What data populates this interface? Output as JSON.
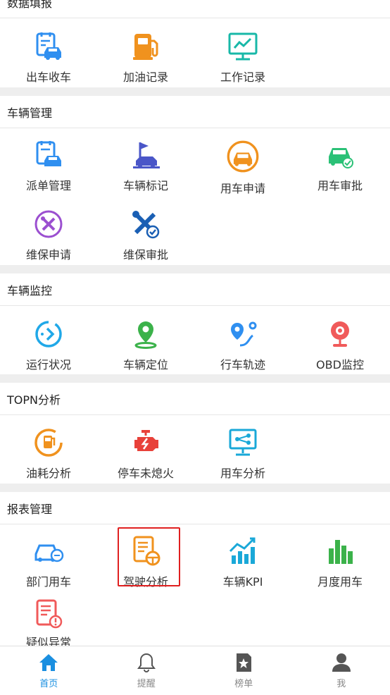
{
  "sections": {
    "data_entry": {
      "title": "数据填报",
      "items": [
        "出车收车",
        "加油记录",
        "工作记录"
      ]
    },
    "vehicle_mgmt": {
      "title": "车辆管理",
      "items": [
        "派单管理",
        "车辆标记",
        "用车申请",
        "用车审批",
        "维保申请",
        "维保审批"
      ]
    },
    "vehicle_monitor": {
      "title": "车辆监控",
      "items": [
        "运行状况",
        "车辆定位",
        "行车轨迹",
        "OBD监控"
      ]
    },
    "topn": {
      "title": "TOPN分析",
      "items": [
        "油耗分析",
        "停车未熄火",
        "用车分析"
      ]
    },
    "reports": {
      "title": "报表管理",
      "items": [
        "部门用车",
        "驾驶分析",
        "车辆KPI",
        "月度用车",
        "疑似异常"
      ]
    }
  },
  "tabbar": {
    "items": [
      "首页",
      "提醒",
      "榜单",
      "我"
    ],
    "active": "首页"
  },
  "colors": {
    "accent": "#1a8fe0",
    "highlight_border": "#e02020"
  }
}
